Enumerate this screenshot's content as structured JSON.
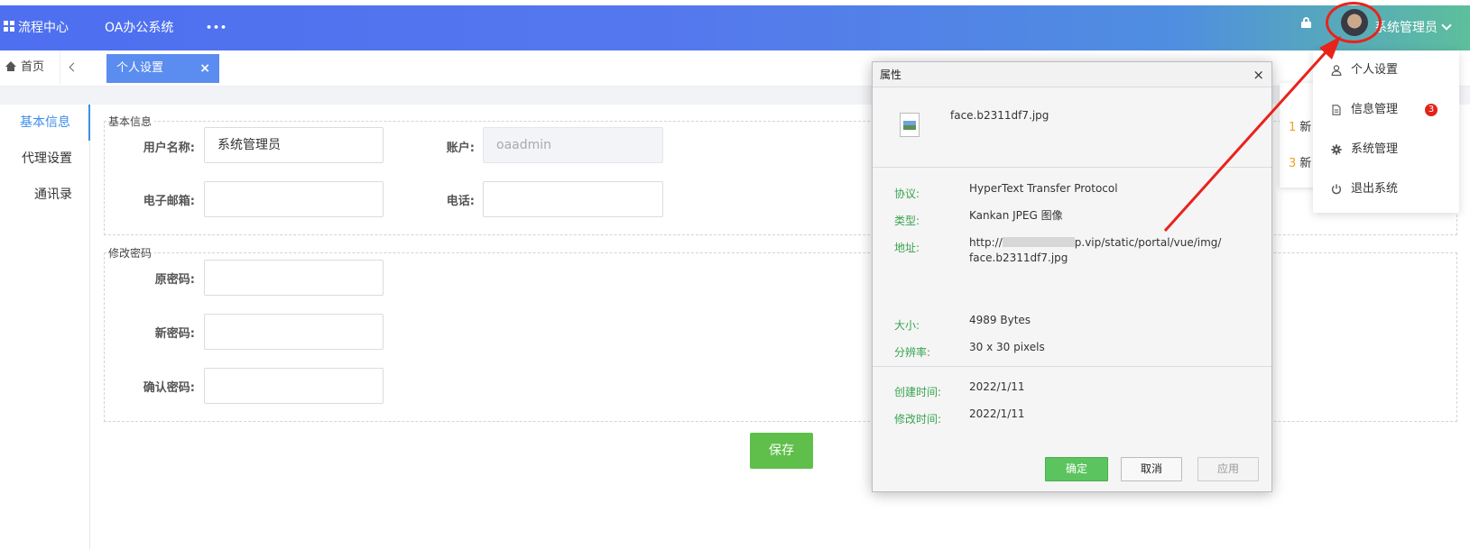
{
  "topbar": {
    "process_center": "流程中心",
    "oa_system": "OA办公系统",
    "more": "•••",
    "user_name": "系统管理员"
  },
  "tabbar": {
    "home": "首页",
    "active_tab": "个人设置",
    "close": "×"
  },
  "left_menu": {
    "items": [
      {
        "label": "基本信息"
      },
      {
        "label": "代理设置"
      },
      {
        "label": "通讯录"
      }
    ]
  },
  "basic_info": {
    "legend": "基本信息",
    "username_label": "用户名称:",
    "username_value": "系统管理员",
    "account_label": "账户:",
    "account_value": "oaadmin",
    "email_label": "电子邮箱:",
    "email_value": "",
    "phone_label": "电话:",
    "phone_value": ""
  },
  "password": {
    "legend": "修改密码",
    "old_label": "原密码:",
    "new_label": "新密码:",
    "confirm_label": "确认密码:"
  },
  "save_label": "保存",
  "properties": {
    "title": "属性",
    "close": "×",
    "file_name": "face.b2311df7.jpg",
    "protocol_key": "协议:",
    "protocol_value": "HyperText Transfer Protocol",
    "type_key": "类型:",
    "type_value": "Kankan JPEG 图像",
    "address_key": "地址:",
    "address_prefix": "http://",
    "address_rest": "p.vip/static/portal/vue/img/",
    "address_line2": "face.b2311df7.jpg",
    "size_key": "大小:",
    "size_value": "4989 Bytes",
    "resolution_key": "分辨率:",
    "resolution_value": "30 x 30 pixels",
    "created_key": "创建时间:",
    "created_value": "2022/1/11",
    "modified_key": "修改时间:",
    "modified_value": "2022/1/11",
    "ok_label": "确定",
    "cancel_label": "取消",
    "apply_label": "应用"
  },
  "notice_panel": {
    "items": [
      {
        "num": "1",
        "text": "新"
      },
      {
        "num": "3",
        "text": "新"
      }
    ]
  },
  "user_dropdown": {
    "items": [
      {
        "label": "个人设置",
        "icon": "user-icon"
      },
      {
        "label": "信息管理",
        "icon": "document-icon",
        "badge": "3"
      },
      {
        "label": "系统管理",
        "icon": "gear-icon"
      },
      {
        "label": "退出系统",
        "icon": "power-icon"
      }
    ]
  },
  "colors": {
    "accent": "#5b8df0",
    "save": "#5fbf4a",
    "annotation": "#e8231b",
    "badge": "#e2231a"
  }
}
